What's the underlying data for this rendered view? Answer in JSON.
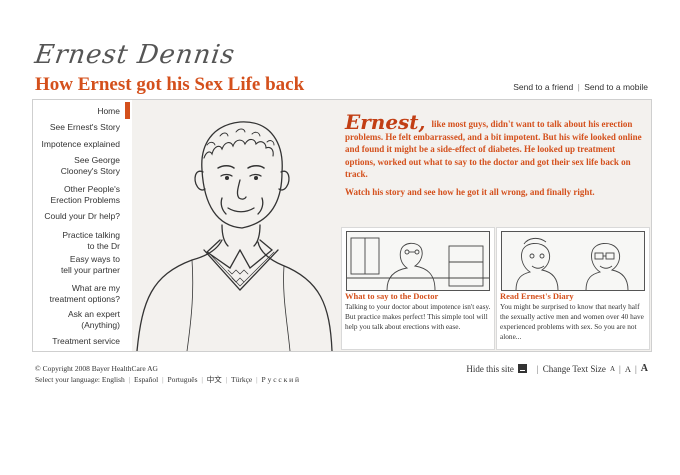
{
  "header": {
    "logo_text": "Ernest Dennis",
    "title": "How Ernest got his Sex Life back",
    "links": [
      "Send to a friend",
      "Send to a mobile"
    ]
  },
  "sidebar": {
    "items": [
      {
        "label": "Home",
        "active": true
      },
      {
        "label": "See Ernest's Story"
      },
      {
        "label": "Impotence explained"
      },
      {
        "label": "See George Clooney's Story",
        "lines": [
          "See George",
          "Clooney's Story"
        ]
      },
      {
        "label": "Other People's Erection Problems",
        "lines": [
          "Other People's",
          "Erection Problems"
        ]
      },
      {
        "label": "Could your Dr help?"
      },
      {
        "label": "Practice talking to the Dr",
        "lines": [
          "Practice talking",
          "to the Dr"
        ]
      },
      {
        "label": "Easy ways to tell your partner",
        "lines": [
          "Easy ways to",
          "tell your partner"
        ]
      },
      {
        "label": "What are my treatment options?",
        "lines": [
          "What are my",
          "treatment options?"
        ]
      },
      {
        "label": "Ask an expert (Anything)",
        "lines": [
          "Ask an expert",
          "(Anything)"
        ]
      },
      {
        "label": "Treatment service"
      }
    ]
  },
  "intro": {
    "name": "Ernest,",
    "paragraph1": "like most guys, didn't want to talk about his erection problems. He felt embarrassed, and a bit impotent. But his wife looked online and found it might be a side-effect of diabetes. He looked up treatment options, worked out what to say to the doctor and got their sex life back on track.",
    "paragraph2": "Watch his story and see how he got it all wrong, and finally right."
  },
  "cards": [
    {
      "title": "What to say to the Doctor",
      "text": "Talking to your doctor about impotence isn't easy. But practice makes perfect! This simple tool will help you talk about erections with ease."
    },
    {
      "title": "Read Ernest's Diary",
      "text": "You might be surprised to know that nearly half the sexually active men and women over 40 have experienced problems with sex. So you are not alone..."
    }
  ],
  "footer": {
    "copyright": "© Copyright 2008 Bayer HealthCare AG",
    "language_label": "Select your language:",
    "languages": [
      "English",
      "Español",
      "Português",
      "中文",
      "Türkçe",
      "Р у с с к и й"
    ],
    "hide_label": "Hide this site",
    "text_size_label": "Change Text Size",
    "size_options": [
      "A",
      "A",
      "A"
    ]
  },
  "colors": {
    "accent": "#d4501c",
    "text": "#333333",
    "panel": "#f3f1ee"
  }
}
